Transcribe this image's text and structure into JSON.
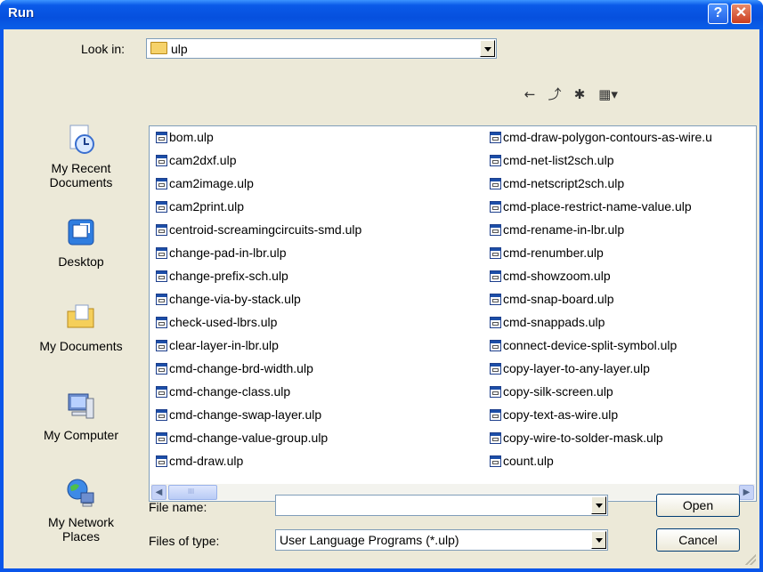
{
  "window": {
    "title": "Run",
    "help_glyph": "?",
    "close_glyph": "✕"
  },
  "look_in": {
    "label": "Look in:",
    "value": "ulp"
  },
  "toolbar": {
    "back_glyph": "←",
    "up_glyph": "⤴",
    "new_folder_glyph": "✱",
    "views_glyph": "▦▾"
  },
  "places": [
    {
      "label": "My Recent\nDocuments",
      "icon": "recent-documents-icon"
    },
    {
      "label": "Desktop",
      "icon": "desktop-icon"
    },
    {
      "label": "My Documents",
      "icon": "my-documents-icon"
    },
    {
      "label": "My Computer",
      "icon": "my-computer-icon"
    },
    {
      "label": "My Network\nPlaces",
      "icon": "network-places-icon"
    }
  ],
  "files": {
    "column1": [
      "bom.ulp",
      "cam2dxf.ulp",
      "cam2image.ulp",
      "cam2print.ulp",
      "centroid-screamingcircuits-smd.ulp",
      "change-pad-in-lbr.ulp",
      "change-prefix-sch.ulp",
      "change-via-by-stack.ulp",
      "check-used-lbrs.ulp",
      "clear-layer-in-lbr.ulp",
      "cmd-change-brd-width.ulp",
      "cmd-change-class.ulp",
      "cmd-change-swap-layer.ulp",
      "cmd-change-value-group.ulp",
      "cmd-draw.ulp"
    ],
    "column2": [
      "cmd-draw-polygon-contours-as-wire.u",
      "cmd-net-list2sch.ulp",
      "cmd-netscript2sch.ulp",
      "cmd-place-restrict-name-value.ulp",
      "cmd-rename-in-lbr.ulp",
      "cmd-renumber.ulp",
      "cmd-showzoom.ulp",
      "cmd-snap-board.ulp",
      "cmd-snappads.ulp",
      "connect-device-split-symbol.ulp",
      "copy-layer-to-any-layer.ulp",
      "copy-silk-screen.ulp",
      "copy-text-as-wire.ulp",
      "copy-wire-to-solder-mask.ulp",
      "count.ulp"
    ]
  },
  "scrollbar": {
    "left_arrow": "◀",
    "right_arrow": "▶"
  },
  "file_name": {
    "label": "File name:",
    "value": ""
  },
  "files_of_type": {
    "label": "Files of type:",
    "value": "User Language Programs (*.ulp)"
  },
  "buttons": {
    "open": "Open",
    "cancel": "Cancel"
  }
}
